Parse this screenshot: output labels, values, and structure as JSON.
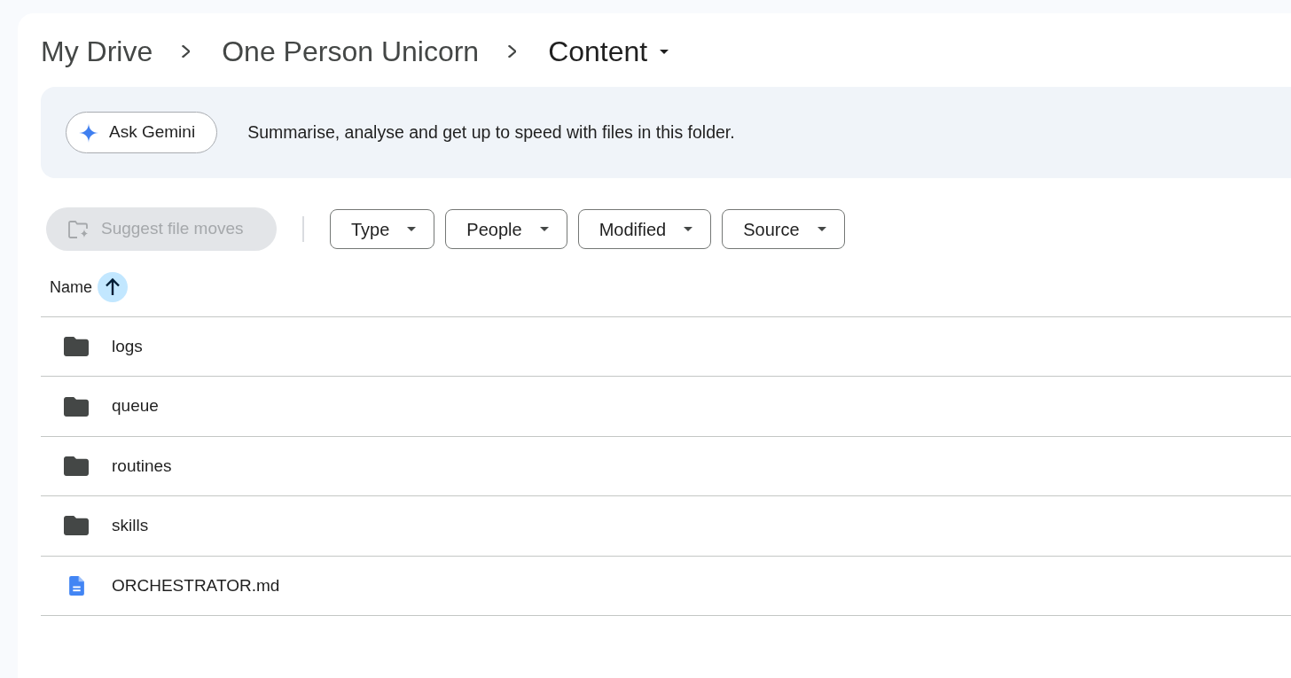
{
  "breadcrumb": [
    {
      "label": "My Drive",
      "current": false
    },
    {
      "label": "One Person Unicorn",
      "current": false
    },
    {
      "label": "Content",
      "current": true
    }
  ],
  "gemini_banner": {
    "button": "Ask Gemini",
    "text": "Summarise, analyse and get up to speed with files in this folder."
  },
  "toolbar": {
    "suggest_button": {
      "label": "Suggest file moves",
      "disabled": true
    },
    "filters": [
      "Type",
      "People",
      "Modified",
      "Source"
    ]
  },
  "file_list": {
    "columns": [
      {
        "label": "Name",
        "sort_ascending": true
      }
    ],
    "rows": [
      {
        "name": "logs",
        "kind": "folder"
      },
      {
        "name": "queue",
        "kind": "folder"
      },
      {
        "name": "routines",
        "kind": "folder"
      },
      {
        "name": "skills",
        "kind": "folder"
      },
      {
        "name": "ORCHESTRATOR.md",
        "kind": "document"
      }
    ]
  }
}
